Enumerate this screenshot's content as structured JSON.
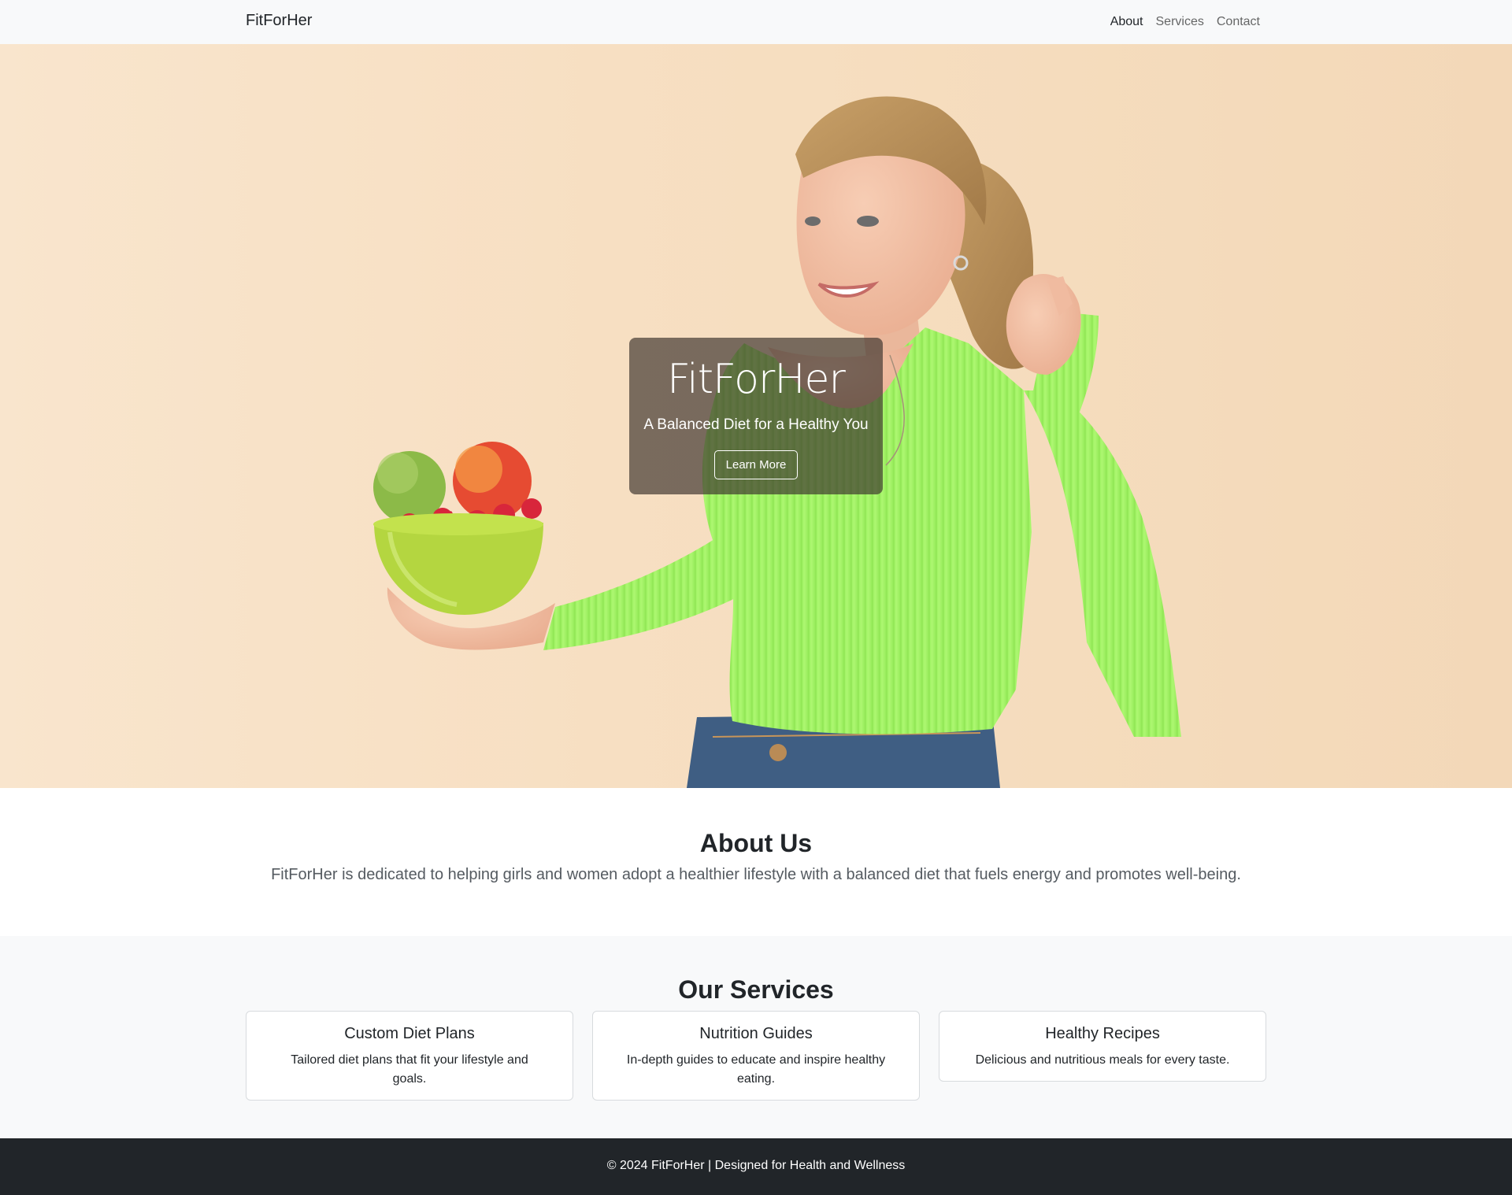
{
  "navbar": {
    "brand": "FitForHer",
    "links": [
      {
        "label": "About",
        "active": true
      },
      {
        "label": "Services",
        "active": false
      },
      {
        "label": "Contact",
        "active": false
      }
    ]
  },
  "hero": {
    "title": "FitForHer",
    "subtitle": "A Balanced Diet for a Healthy You",
    "button_label": "Learn More",
    "image_icon": "woman-with-fruit-bowl-photo"
  },
  "about": {
    "heading": "About Us",
    "text": "FitForHer is dedicated to helping girls and women adopt a healthier lifestyle with a balanced diet that fuels energy and promotes well-being."
  },
  "services": {
    "heading": "Our Services",
    "cards": [
      {
        "title": "Custom Diet Plans",
        "text": "Tailored diet plans that fit your lifestyle and goals."
      },
      {
        "title": "Nutrition Guides",
        "text": "In-depth guides to educate and inspire healthy eating."
      },
      {
        "title": "Healthy Recipes",
        "text": "Delicious and nutritious meals for every taste."
      }
    ]
  },
  "footer": {
    "text": "© 2024 FitForHer | Designed for Health and Wellness"
  },
  "colors": {
    "navbar_bg": "#f8f9fa",
    "hero_bg": "#f7dfc2",
    "overlay": "#3c342d",
    "footer_bg": "#212529",
    "shirt_green": "#a6f56a"
  }
}
